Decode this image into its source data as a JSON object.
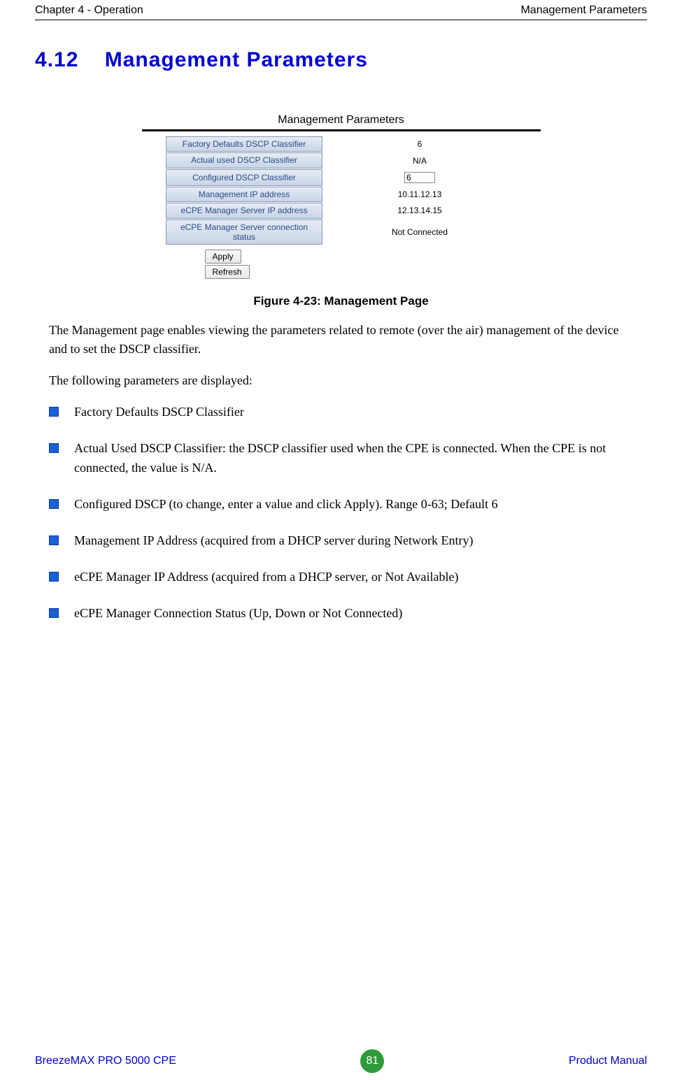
{
  "header": {
    "left": "Chapter 4 - Operation",
    "right": "Management Parameters"
  },
  "section": {
    "number": "4.12",
    "title": "Management Parameters"
  },
  "screenshot": {
    "panel_title": "Management Parameters",
    "rows": [
      {
        "label": "Factory Defaults DSCP Classifier",
        "value": "6",
        "input": false
      },
      {
        "label": "Actual used DSCP Classifier",
        "value": "N/A",
        "input": false
      },
      {
        "label": "Configured DSCP Classifier",
        "value": "6",
        "input": true
      },
      {
        "label": "Management IP address",
        "value": "10.11.12.13",
        "input": false
      },
      {
        "label": "eCPE Manager Server IP address",
        "value": "12.13.14.15",
        "input": false
      },
      {
        "label": "eCPE Manager Server connection status",
        "value": "Not Connected",
        "input": false
      }
    ],
    "buttons": {
      "apply": "Apply",
      "refresh": "Refresh"
    }
  },
  "figure_caption": "Figure 4-23: Management Page",
  "paragraphs": {
    "intro": "The Management page enables viewing the parameters related to remote (over the air) management of the device and to set the DSCP classifier.",
    "following": "The following parameters are displayed:"
  },
  "bullets": [
    "Factory Defaults DSCP Classifier",
    "Actual Used DSCP Classifier: the DSCP classifier used when the CPE is connected. When the CPE is not connected, the value is N/A.",
    "Configured DSCP (to change, enter a value and click Apply). Range 0-63; Default 6",
    "Management IP Address (acquired from a DHCP server during Network Entry)",
    "eCPE Manager IP Address (acquired from a DHCP server, or Not Available)",
    "eCPE Manager Connection Status (Up, Down or Not Connected)"
  ],
  "footer": {
    "left": "BreezeMAX PRO 5000 CPE",
    "page": "81",
    "right": "Product Manual"
  }
}
